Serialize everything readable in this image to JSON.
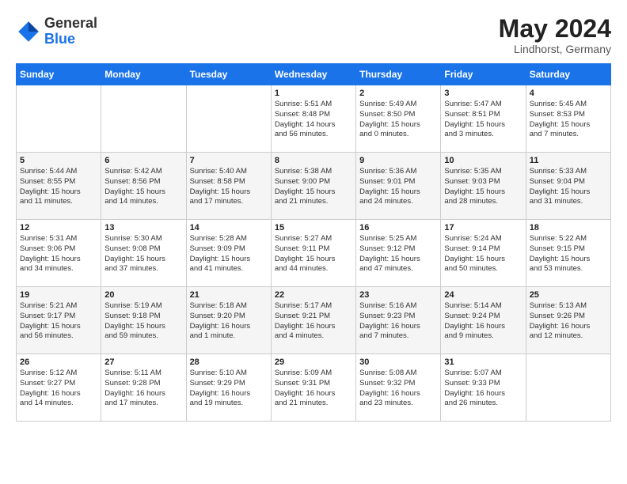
{
  "header": {
    "logo_line1": "General",
    "logo_line2": "Blue",
    "month": "May 2024",
    "location": "Lindhorst, Germany"
  },
  "weekdays": [
    "Sunday",
    "Monday",
    "Tuesday",
    "Wednesday",
    "Thursday",
    "Friday",
    "Saturday"
  ],
  "weeks": [
    [
      {
        "day": "",
        "text": ""
      },
      {
        "day": "",
        "text": ""
      },
      {
        "day": "",
        "text": ""
      },
      {
        "day": "1",
        "text": "Sunrise: 5:51 AM\nSunset: 8:48 PM\nDaylight: 14 hours\nand 56 minutes."
      },
      {
        "day": "2",
        "text": "Sunrise: 5:49 AM\nSunset: 8:50 PM\nDaylight: 15 hours\nand 0 minutes."
      },
      {
        "day": "3",
        "text": "Sunrise: 5:47 AM\nSunset: 8:51 PM\nDaylight: 15 hours\nand 3 minutes."
      },
      {
        "day": "4",
        "text": "Sunrise: 5:45 AM\nSunset: 8:53 PM\nDaylight: 15 hours\nand 7 minutes."
      }
    ],
    [
      {
        "day": "5",
        "text": "Sunrise: 5:44 AM\nSunset: 8:55 PM\nDaylight: 15 hours\nand 11 minutes."
      },
      {
        "day": "6",
        "text": "Sunrise: 5:42 AM\nSunset: 8:56 PM\nDaylight: 15 hours\nand 14 minutes."
      },
      {
        "day": "7",
        "text": "Sunrise: 5:40 AM\nSunset: 8:58 PM\nDaylight: 15 hours\nand 17 minutes."
      },
      {
        "day": "8",
        "text": "Sunrise: 5:38 AM\nSunset: 9:00 PM\nDaylight: 15 hours\nand 21 minutes."
      },
      {
        "day": "9",
        "text": "Sunrise: 5:36 AM\nSunset: 9:01 PM\nDaylight: 15 hours\nand 24 minutes."
      },
      {
        "day": "10",
        "text": "Sunrise: 5:35 AM\nSunset: 9:03 PM\nDaylight: 15 hours\nand 28 minutes."
      },
      {
        "day": "11",
        "text": "Sunrise: 5:33 AM\nSunset: 9:04 PM\nDaylight: 15 hours\nand 31 minutes."
      }
    ],
    [
      {
        "day": "12",
        "text": "Sunrise: 5:31 AM\nSunset: 9:06 PM\nDaylight: 15 hours\nand 34 minutes."
      },
      {
        "day": "13",
        "text": "Sunrise: 5:30 AM\nSunset: 9:08 PM\nDaylight: 15 hours\nand 37 minutes."
      },
      {
        "day": "14",
        "text": "Sunrise: 5:28 AM\nSunset: 9:09 PM\nDaylight: 15 hours\nand 41 minutes."
      },
      {
        "day": "15",
        "text": "Sunrise: 5:27 AM\nSunset: 9:11 PM\nDaylight: 15 hours\nand 44 minutes."
      },
      {
        "day": "16",
        "text": "Sunrise: 5:25 AM\nSunset: 9:12 PM\nDaylight: 15 hours\nand 47 minutes."
      },
      {
        "day": "17",
        "text": "Sunrise: 5:24 AM\nSunset: 9:14 PM\nDaylight: 15 hours\nand 50 minutes."
      },
      {
        "day": "18",
        "text": "Sunrise: 5:22 AM\nSunset: 9:15 PM\nDaylight: 15 hours\nand 53 minutes."
      }
    ],
    [
      {
        "day": "19",
        "text": "Sunrise: 5:21 AM\nSunset: 9:17 PM\nDaylight: 15 hours\nand 56 minutes."
      },
      {
        "day": "20",
        "text": "Sunrise: 5:19 AM\nSunset: 9:18 PM\nDaylight: 15 hours\nand 59 minutes."
      },
      {
        "day": "21",
        "text": "Sunrise: 5:18 AM\nSunset: 9:20 PM\nDaylight: 16 hours\nand 1 minute."
      },
      {
        "day": "22",
        "text": "Sunrise: 5:17 AM\nSunset: 9:21 PM\nDaylight: 16 hours\nand 4 minutes."
      },
      {
        "day": "23",
        "text": "Sunrise: 5:16 AM\nSunset: 9:23 PM\nDaylight: 16 hours\nand 7 minutes."
      },
      {
        "day": "24",
        "text": "Sunrise: 5:14 AM\nSunset: 9:24 PM\nDaylight: 16 hours\nand 9 minutes."
      },
      {
        "day": "25",
        "text": "Sunrise: 5:13 AM\nSunset: 9:26 PM\nDaylight: 16 hours\nand 12 minutes."
      }
    ],
    [
      {
        "day": "26",
        "text": "Sunrise: 5:12 AM\nSunset: 9:27 PM\nDaylight: 16 hours\nand 14 minutes."
      },
      {
        "day": "27",
        "text": "Sunrise: 5:11 AM\nSunset: 9:28 PM\nDaylight: 16 hours\nand 17 minutes."
      },
      {
        "day": "28",
        "text": "Sunrise: 5:10 AM\nSunset: 9:29 PM\nDaylight: 16 hours\nand 19 minutes."
      },
      {
        "day": "29",
        "text": "Sunrise: 5:09 AM\nSunset: 9:31 PM\nDaylight: 16 hours\nand 21 minutes."
      },
      {
        "day": "30",
        "text": "Sunrise: 5:08 AM\nSunset: 9:32 PM\nDaylight: 16 hours\nand 23 minutes."
      },
      {
        "day": "31",
        "text": "Sunrise: 5:07 AM\nSunset: 9:33 PM\nDaylight: 16 hours\nand 26 minutes."
      },
      {
        "day": "",
        "text": ""
      }
    ]
  ]
}
